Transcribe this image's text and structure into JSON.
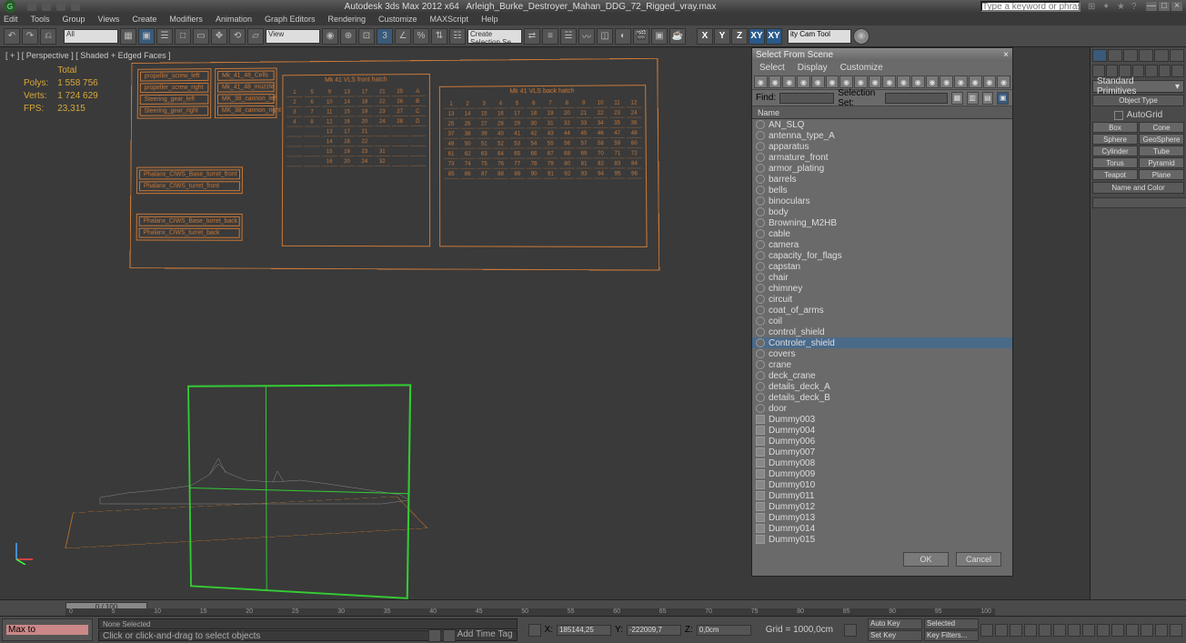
{
  "title": {
    "app": "Autodesk 3ds Max  2012 x64",
    "file": "Arleigh_Burke_Destroyer_Mahan_DDG_72_Rigged_vray.max",
    "search_placeholder": "Type a keyword or phrase"
  },
  "menu": [
    "Edit",
    "Tools",
    "Group",
    "Views",
    "Create",
    "Modifiers",
    "Animation",
    "Graph Editors",
    "Rendering",
    "Customize",
    "MAXScript",
    "Help"
  ],
  "axes": [
    "X",
    "Y",
    "Z",
    "XY",
    "XY"
  ],
  "cam_tool": "ity Cam Tool",
  "viewport": {
    "label": "[ + ] [ Perspective ] [ Shaded + Edged Faces ]",
    "stats": {
      "total_label": "Total",
      "polys_label": "Polys:",
      "polys": "1 558 756",
      "verts_label": "Verts:",
      "verts": "1 724 629",
      "fps_label": "FPS:",
      "fps": "23,315"
    }
  },
  "board": {
    "col1": [
      "propeller_screw_left",
      "propeller_screw_right",
      "Steering_gear_left",
      "Steering_gear_right"
    ],
    "col2": [
      "Mk_41_48_Cells",
      "Mk_41_48_muzzle",
      "MK_38_cannon_left",
      "MK_38_cannon_right"
    ],
    "col3": [
      "Phalanx_CIWS_Base_turret_front",
      "Phalanx_CIWS_turret_front"
    ],
    "col4": [
      "Phalanx_CIWS_Base_turret_back",
      "Phalanx_CIWS_turret_back"
    ],
    "grid1": {
      "title": "Mk 41 VLS front hatch",
      "cols": [
        "1",
        "5",
        "9",
        "13",
        "17",
        "21",
        "25",
        "A",
        "2",
        "6",
        "10",
        "14",
        "18",
        "22",
        "26",
        "B",
        "3",
        "7",
        "11",
        "15",
        "19",
        "23",
        "27",
        "C",
        "4",
        "8",
        "12",
        "16",
        "20",
        "24",
        "28",
        "D",
        "",
        "",
        "13",
        "17",
        "21",
        "",
        "",
        "",
        "",
        "",
        "14",
        "18",
        "22",
        "",
        "",
        "",
        "",
        "",
        "15",
        "19",
        "23",
        "31",
        "",
        "",
        "",
        "",
        "16",
        "20",
        "24",
        "32",
        "",
        ""
      ]
    },
    "grid2": {
      "title": "Mk 41 VLS back hatch",
      "cols": []
    }
  },
  "scene_dialog": {
    "title": "Select From Scene",
    "menu": [
      "Select",
      "Display",
      "Customize"
    ],
    "find_label": "Find:",
    "selset_label": "Selection Set:",
    "header": "Name",
    "items": [
      {
        "n": "AN_SLQ",
        "t": "o"
      },
      {
        "n": "antenna_type_A",
        "t": "o"
      },
      {
        "n": "apparatus",
        "t": "o"
      },
      {
        "n": "armature_front",
        "t": "o"
      },
      {
        "n": "armor_plating",
        "t": "o"
      },
      {
        "n": "barrels",
        "t": "o"
      },
      {
        "n": "bells",
        "t": "o"
      },
      {
        "n": "binoculars",
        "t": "o"
      },
      {
        "n": "body",
        "t": "o"
      },
      {
        "n": "Browning_M2HB",
        "t": "o"
      },
      {
        "n": "cable",
        "t": "o"
      },
      {
        "n": "camera",
        "t": "o"
      },
      {
        "n": "capacity_for_flags",
        "t": "o"
      },
      {
        "n": "capstan",
        "t": "o"
      },
      {
        "n": "chair",
        "t": "o"
      },
      {
        "n": "chimney",
        "t": "o"
      },
      {
        "n": "circuit",
        "t": "o"
      },
      {
        "n": "coat_of_arms",
        "t": "o"
      },
      {
        "n": "coil",
        "t": "o"
      },
      {
        "n": "control_shield",
        "t": "o"
      },
      {
        "n": "Controler_shield",
        "t": "o",
        "sel": true
      },
      {
        "n": "covers",
        "t": "o"
      },
      {
        "n": "crane",
        "t": "o"
      },
      {
        "n": "deck_crane",
        "t": "o"
      },
      {
        "n": "details_deck_A",
        "t": "o"
      },
      {
        "n": "details_deck_B",
        "t": "o"
      },
      {
        "n": "door",
        "t": "o"
      },
      {
        "n": "Dummy003",
        "t": "d"
      },
      {
        "n": "Dummy004",
        "t": "d"
      },
      {
        "n": "Dummy006",
        "t": "d"
      },
      {
        "n": "Dummy007",
        "t": "d"
      },
      {
        "n": "Dummy008",
        "t": "d"
      },
      {
        "n": "Dummy009",
        "t": "d"
      },
      {
        "n": "Dummy010",
        "t": "d"
      },
      {
        "n": "Dummy011",
        "t": "d"
      },
      {
        "n": "Dummy012",
        "t": "d"
      },
      {
        "n": "Dummy013",
        "t": "d"
      },
      {
        "n": "Dummy014",
        "t": "d"
      },
      {
        "n": "Dummy015",
        "t": "d"
      }
    ],
    "ok": "OK",
    "cancel": "Cancel"
  },
  "cmd": {
    "category": "Standard Primitives",
    "obj_type": "Object Type",
    "autogrid": "AutoGrid",
    "prims": [
      [
        "Box",
        "Cone"
      ],
      [
        "Sphere",
        "GeoSphere"
      ],
      [
        "Cylinder",
        "Tube"
      ],
      [
        "Torus",
        "Pyramid"
      ],
      [
        "Teapot",
        "Plane"
      ]
    ],
    "name_color": "Name and Color"
  },
  "timeline": {
    "pos": "0 / 100",
    "ticks": [
      "0",
      "5",
      "10",
      "15",
      "20",
      "25",
      "30",
      "35",
      "40",
      "45",
      "50",
      "55",
      "60",
      "65",
      "70",
      "75",
      "80",
      "85",
      "90",
      "95",
      "100"
    ]
  },
  "status": {
    "left1": "",
    "left2": "Max to",
    "sel": "None Selected",
    "prompt": "Click or click-and-drag to select objects",
    "x_label": "X:",
    "x": "185144,25",
    "y_label": "Y:",
    "y": "-222009,7",
    "z_label": "Z:",
    "z": "0,0cm",
    "grid": "Grid = 1000,0cm",
    "autokey": "Auto Key",
    "setkey": "Set Key",
    "selected": "Selected",
    "timetag": "Add Time Tag",
    "keyfilters": "Key Filters..."
  }
}
